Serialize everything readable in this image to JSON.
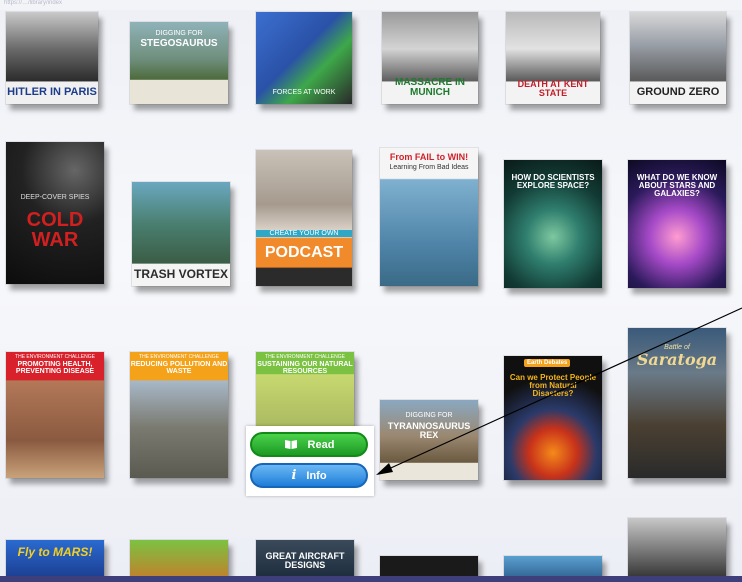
{
  "topbar": {
    "text": "https://…/library/index"
  },
  "books": [
    {
      "title": "HITLER IN PARIS",
      "sub": ""
    },
    {
      "title": "STEGOSAURUS",
      "sub": "DIGGING FOR"
    },
    {
      "title": "",
      "sub": "FORCES AT WORK"
    },
    {
      "title": "MASSACRE IN MUNICH",
      "sub": ""
    },
    {
      "title": "DEATH AT KENT STATE",
      "sub": ""
    },
    {
      "title": "GROUND ZERO",
      "sub": ""
    },
    {
      "title": "COLD WAR",
      "sub": "DEEP-COVER SPIES"
    },
    {
      "title": "TRASH VORTEX",
      "sub": ""
    },
    {
      "title": "PODCAST",
      "sub": "CREATE YOUR OWN"
    },
    {
      "title": "From FAIL to WIN!",
      "sub": "Learning From Bad Ideas"
    },
    {
      "title": "HOW DO SCIENTISTS EXPLORE SPACE?",
      "sub": ""
    },
    {
      "title": "WHAT DO WE KNOW ABOUT STARS AND GALAXIES?",
      "sub": ""
    },
    {
      "title": "PROMOTING HEALTH, PREVENTING DISEASE",
      "sub": "THE ENVIRONMENT CHALLENGE"
    },
    {
      "title": "REDUCING POLLUTION AND WASTE",
      "sub": "THE ENVIRONMENT CHALLENGE"
    },
    {
      "title": "SUSTAINING OUR NATURAL RESOURCES",
      "sub": "THE ENVIRONMENT CHALLENGE"
    },
    {
      "title": "TYRANNOSAURUS REX",
      "sub": "DIGGING FOR"
    },
    {
      "title": "Can we Protect People from Natural Disasters?",
      "sub": "Earth Debates"
    },
    {
      "title": "Saratoga",
      "sub": "Battle of"
    },
    {
      "title": "Fly to MARS!",
      "sub": ""
    },
    {
      "title": "",
      "sub": ""
    },
    {
      "title": "GREAT AIRCRAFT DESIGNS",
      "sub": ""
    },
    {
      "title": "",
      "sub": ""
    },
    {
      "title": "",
      "sub": ""
    },
    {
      "title": "",
      "sub": ""
    }
  ],
  "menu": {
    "read_label": "Read",
    "info_label": "Info"
  },
  "colors": {
    "read": "#22a82a",
    "info": "#2a86dd",
    "arrow": "#000000"
  }
}
